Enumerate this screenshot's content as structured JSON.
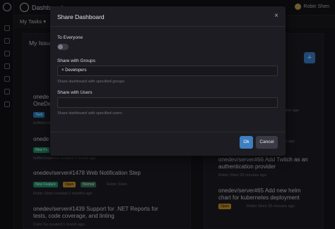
{
  "app": {
    "title": "Dashboards",
    "tab": "My Tasks ▾"
  },
  "user": {
    "name": "Robin Shen"
  },
  "left": {
    "title": "My Issues",
    "items": [
      {
        "title": "onedev/server#1478  Web Notification Step",
        "meta": "Robin Shen  created 2 months ago",
        "tags": [
          "New Feature",
          "Open",
          "Normal"
        ],
        "assignee": "Robin Shen"
      },
      {
        "title": "onedev/server#1439  Support for .NET Reports for",
        "title2": "tests, code coverage, and linting",
        "meta": "Colin Xu  created 1 month ago"
      }
    ],
    "other": [
      "onede",
      "OneDe",
      "onede",
      "Task",
      "buffetUnderrun",
      "New Fe",
      "bufferUnderrun  created 2 month ago"
    ]
  },
  "right": {
    "items": [
      {
        "title": "onedev/server#66  Add Twitch as an",
        "title2": "authentication provider",
        "meta": "Robin Shen  35 minutes ago"
      },
      {
        "title": "onedev/server#65  Add new helm",
        "title2": "chart for kubernetes deployment",
        "meta": "Robin Shen  35 minutes ago",
        "tag": "Open"
      }
    ],
    "fragments": [
      "4",
      "gent",
      "minutes ago",
      "uage",
      "nutes ago"
    ]
  },
  "modal": {
    "title": "Share Dashboard",
    "everyone_label": "To Everyone",
    "groups_label": "Share with Groups",
    "group_chip": "× Developers",
    "groups_hint": "Share dashboard with specified groups",
    "users_label": "Share with Users",
    "users_hint": "Share dashboard with specified users",
    "ok": "Ok",
    "cancel": "Cancel"
  },
  "colors": {
    "accent": "#3e7fc1",
    "plus": "#3c86d6",
    "tag_task": "#1f8ad1",
    "tag_feature": "#1e9a6f",
    "tag_open": "#d89a2b",
    "tag_normal": "#3a7a5a"
  }
}
